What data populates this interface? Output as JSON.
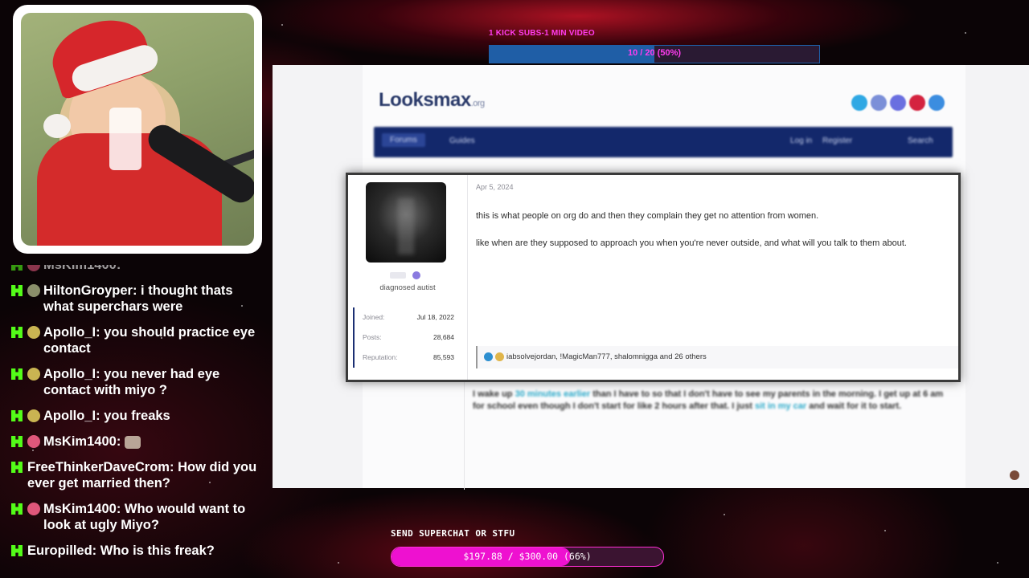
{
  "kick_sub_goal": {
    "title": "1 KICK SUBS-1 MIN VIDEO",
    "progress_text": "10 / 20 (50%)",
    "progress_fraction": 0.5,
    "bar_color": "#1f5ea6",
    "text_color": "#ff3cf0"
  },
  "chat": {
    "badge_color": "#53fc18",
    "messages": [
      {
        "user": "MsKim1400",
        "text": "",
        "avatar_color": "#e0577b",
        "partial": true
      },
      {
        "user": "HiltonGroyper",
        "text": "i thought thats what superchars were",
        "avatar_color": "#8a8f6a"
      },
      {
        "user": "Apollo_I",
        "text": "you should practice eye contact",
        "avatar_color": "#c9b452"
      },
      {
        "user": "Apollo_I",
        "text": "you never had eye contact with miyo ?",
        "avatar_color": "#c9b452"
      },
      {
        "user": "Apollo_I",
        "text": "you freaks",
        "avatar_color": "#c9b452"
      },
      {
        "user": "MsKim1400",
        "text": "",
        "avatar_color": "#e0577b",
        "emote": "cat-emote"
      },
      {
        "user": "FreeThinkerDaveCrom",
        "text": "How did you ever get married then?",
        "avatar_color": ""
      },
      {
        "user": "MsKim1400",
        "text": "Who would want to look at ugly Miyo?",
        "avatar_color": "#e0577b"
      },
      {
        "user": "Europilled",
        "text": "Who is this freak?",
        "avatar_color": ""
      }
    ]
  },
  "site": {
    "logo": "Looksmax",
    "logo_suffix": ".org",
    "social_icons": [
      {
        "name": "twitter-icon",
        "color": "#2fa8e4"
      },
      {
        "name": "instagram-icon",
        "color": "#7b8fd8"
      },
      {
        "name": "discord-icon",
        "color": "#6a6fe0"
      },
      {
        "name": "pinterest-icon",
        "color": "#d4233f"
      },
      {
        "name": "mail-icon",
        "color": "#3b8de0"
      }
    ],
    "nav": {
      "forums": "Forums",
      "guides": "Guides",
      "login": "Log in",
      "register": "Register",
      "search": "Search"
    }
  },
  "post": {
    "date": "Apr 5, 2024",
    "user_title": "diagnosed autist",
    "stats": [
      {
        "key": "Joined:",
        "value": "Jul 18, 2022"
      },
      {
        "key": "Posts:",
        "value": "28,684"
      },
      {
        "key": "Reputation:",
        "value": "85,593"
      }
    ],
    "paragraphs": [
      "this is what people on org do and then they complain they get no attention from women.",
      "like when are they supposed to approach you when you're never outside, and what will you talk to them about."
    ],
    "reactions_text": "iabsolvejordan, !MagicMan777, shalomnigga and 26 others"
  },
  "post_below": {
    "text_before": "I wake up ",
    "highlight1": "30 minutes earlier",
    "text_mid": " than I have to so that I don't have to see my parents in the morning. I get up at 6 am for school even though I don't start for like 2 hours after that. I just ",
    "highlight2": "sit in my car",
    "text_after": " and wait for it to start."
  },
  "superchat": {
    "title": "SEND SUPERCHAT OR STFU",
    "progress_text": "$197.88 / $300.00 (66%)",
    "progress_fraction": 0.66,
    "fill_color": "#ee11d0"
  }
}
